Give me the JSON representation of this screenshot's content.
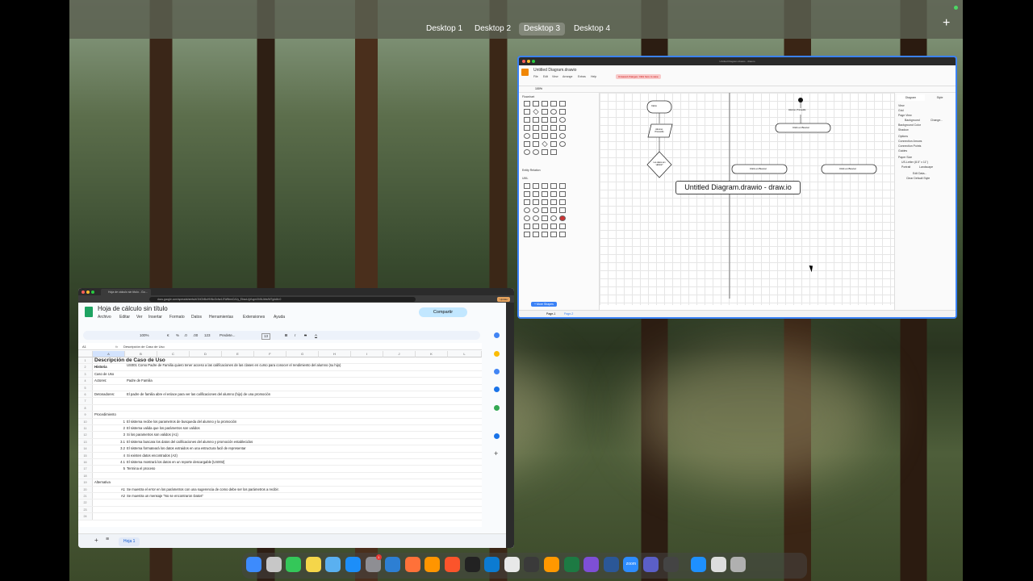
{
  "spaces_bar": {
    "desktops": [
      "Desktop 1",
      "Desktop 2",
      "Desktop 3",
      "Desktop 4"
    ],
    "active_index": 2,
    "add_label": "+"
  },
  "drawio": {
    "window_title": "Untitled Diagram.drawio - draw.io",
    "doc_title": "Untitled Diagram.drawio",
    "menus": [
      "File",
      "Edit",
      "View",
      "Arrange",
      "Extras",
      "Help"
    ],
    "unsaved_notice": "Unsaved changes. Click here to save.",
    "zoom": "100%",
    "shape_sections": [
      "Flowchart",
      "Entity Relation",
      "UML"
    ],
    "more_shapes": "+ More Shapes",
    "right_tabs": [
      "Diagram",
      "Style"
    ],
    "view_label": "View",
    "options": [
      "Grid",
      "Page View",
      "Background",
      "Background Color",
      "Shadow"
    ],
    "change_label": "Change...",
    "options2_label": "Options",
    "options2": [
      "Connection Arrows",
      "Connection Points",
      "Guides"
    ],
    "paper_size_label": "Paper Size",
    "paper_size": "US-Letter (8.5\" x 11\")",
    "orientation": [
      "Portrait",
      "Landscape"
    ],
    "edit_data": "Edit Data...",
    "clear_default": "Clear Default Style",
    "pages": [
      "Page-1",
      "Page-2"
    ],
    "diagram": {
      "inicio": "Inicio",
      "alumno_promedio": "Alumno, Promedio",
      "decision": "Los datos son válidos?",
      "alumno_promedio_right": "Alumno, Promedio",
      "click_buscar_1": "Click en Buscar",
      "click_buscar_2": "Click en Buscar",
      "click_buscar_3": "Click en Buscar"
    },
    "tooltip": "Untitled Diagram.drawio - draw.io"
  },
  "sheets": {
    "tab_title": "Hoja de cálculo sin título - Go...",
    "url": "docs.google.com/spreadsheets/d/1NGhBuHNNcOcfw4-EWItbmCA1y_EbsoUgYugmXhNUbIw9t/7g#dit=0",
    "update_label": "Update",
    "title": "Hoja de cálculo sin título",
    "menus": [
      "Archivo",
      "Editar",
      "Ver",
      "Insertar",
      "Formato",
      "Datos",
      "Herramientas",
      "Extensiones",
      "Ayuda"
    ],
    "share_label": "Compartir",
    "toolbar": {
      "zoom": "100%",
      "currency": "€",
      "percent": "%",
      "dec_down": ".0",
      "dec_up": ".00",
      "format123": "123",
      "font": "Predete...",
      "font_size": "13",
      "bold": "B",
      "italic": "I",
      "strike": "S",
      "text_color": "A"
    },
    "name_box": "A1",
    "formula": "Descripción de Caso de Uso",
    "columns": [
      "A",
      "B",
      "C",
      "D",
      "E",
      "F",
      "G",
      "H",
      "I",
      "J",
      "K",
      "L"
    ],
    "rows": [
      {
        "n": "1",
        "a": "Descripción de Caso de Uso",
        "b": "",
        "bold": true
      },
      {
        "n": "2",
        "a": "Historia",
        "b": "US001 Como Padre de Familia quiero tener acceso a las calificaciones de las clases en curso para conocer el rendimiento del alumno (su hijo)",
        "bold_a": true
      },
      {
        "n": "3",
        "a": "Caso de Uso",
        "b": ""
      },
      {
        "n": "4",
        "a": "Actores:",
        "b": "Padre de Familia"
      },
      {
        "n": "5",
        "a": "",
        "b": ""
      },
      {
        "n": "6",
        "a": "Detonadores:",
        "b": "El padre de familia abre el enlace para ver las calificaciones del alumno (hijo) de una promoción"
      },
      {
        "n": "7",
        "a": "",
        "b": ""
      },
      {
        "n": "8",
        "a": "",
        "b": ""
      },
      {
        "n": "9",
        "a": "Procedimiento",
        "b": ""
      },
      {
        "n": "10",
        "a": "1",
        "b": "El sistema recibe los parametros de busqueda del alumno y la promoción",
        "num": true
      },
      {
        "n": "11",
        "a": "2",
        "b": "El sistema valida que los parámetros son validos",
        "num": true
      },
      {
        "n": "12",
        "a": "3",
        "b": "Si los parametros son validos (A1)",
        "num": true
      },
      {
        "n": "13",
        "a": "3.1",
        "b": "El sistema buscara los datos del calificaciones del alumno y promoción establecidos",
        "num": true
      },
      {
        "n": "14",
        "a": "3.2",
        "b": "El sistema formateará los datos extraidos en una estructura facil de representar",
        "num": true
      },
      {
        "n": "15",
        "a": "4",
        "b": "Si existen datos encontrados (A2)",
        "num": true
      },
      {
        "n": "16",
        "a": "4.1",
        "b": "El sistema mostrará los datos en un reporte descargable [US002]",
        "num": true
      },
      {
        "n": "17",
        "a": "5",
        "b": "Termina el proceso",
        "num": true
      },
      {
        "n": "18",
        "a": "",
        "b": ""
      },
      {
        "n": "19",
        "a": "Alternativa",
        "b": ""
      },
      {
        "n": "20",
        "a": "A1",
        "b": "Se muestra el error en los parámetros con una sugerencia de como debe ser los parámetros a recibir.",
        "num": true
      },
      {
        "n": "21",
        "a": "A2",
        "b": "Se muestra un mensaje \"No se encontraron Datos\"",
        "num": true
      },
      {
        "n": "22",
        "a": "",
        "b": ""
      },
      {
        "n": "23",
        "a": "",
        "b": ""
      },
      {
        "n": "24",
        "a": "",
        "b": ""
      }
    ],
    "sheet_tab": "Hoja 1"
  },
  "dock": {
    "apps": [
      "finder-icon",
      "launchpad-icon",
      "messages-icon",
      "notes-icon",
      "folder-icon",
      "app-store-icon",
      "system-settings-icon",
      "vscode-icon",
      "firefox-icon",
      "books-icon",
      "brave-icon",
      "terminal-icon",
      "edge-icon",
      "chrome-icon",
      "activity-monitor-icon",
      "sublime-icon",
      "excel-icon",
      "obsidian-icon",
      "word-icon",
      "zoom-icon",
      "teams-icon",
      "clock-icon",
      "files-icon",
      "preview-icon",
      "trash-icon"
    ],
    "settings_badge": "1",
    "zoom_label": "zoom"
  }
}
